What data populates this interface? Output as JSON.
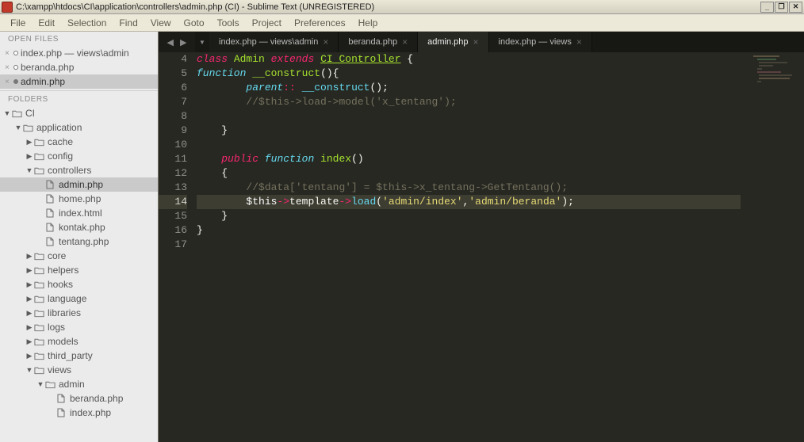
{
  "window": {
    "title": "C:\\xampp\\htdocs\\CI\\application\\controllers\\admin.php (CI) - Sublime Text (UNREGISTERED)"
  },
  "menu": [
    "File",
    "Edit",
    "Selection",
    "Find",
    "View",
    "Goto",
    "Tools",
    "Project",
    "Preferences",
    "Help"
  ],
  "openfiles_head": "OPEN FILES",
  "openfiles": [
    {
      "label": "index.php — views\\admin",
      "active": false
    },
    {
      "label": "beranda.php",
      "active": false
    },
    {
      "label": "admin.php",
      "active": true
    }
  ],
  "folders_head": "FOLDERS",
  "folders": [
    {
      "d": 0,
      "type": "folder",
      "open": true,
      "label": "CI"
    },
    {
      "d": 1,
      "type": "folder",
      "open": true,
      "label": "application"
    },
    {
      "d": 2,
      "type": "folder",
      "open": false,
      "label": "cache"
    },
    {
      "d": 2,
      "type": "folder",
      "open": false,
      "label": "config"
    },
    {
      "d": 2,
      "type": "folder",
      "open": true,
      "label": "controllers"
    },
    {
      "d": 3,
      "type": "file",
      "label": "admin.php",
      "active": true
    },
    {
      "d": 3,
      "type": "file",
      "label": "home.php"
    },
    {
      "d": 3,
      "type": "file",
      "label": "index.html"
    },
    {
      "d": 3,
      "type": "file",
      "label": "kontak.php"
    },
    {
      "d": 3,
      "type": "file",
      "label": "tentang.php"
    },
    {
      "d": 2,
      "type": "folder",
      "open": false,
      "label": "core"
    },
    {
      "d": 2,
      "type": "folder",
      "open": false,
      "label": "helpers"
    },
    {
      "d": 2,
      "type": "folder",
      "open": false,
      "label": "hooks"
    },
    {
      "d": 2,
      "type": "folder",
      "open": false,
      "label": "language"
    },
    {
      "d": 2,
      "type": "folder",
      "open": false,
      "label": "libraries"
    },
    {
      "d": 2,
      "type": "folder",
      "open": false,
      "label": "logs"
    },
    {
      "d": 2,
      "type": "folder",
      "open": false,
      "label": "models"
    },
    {
      "d": 2,
      "type": "folder",
      "open": false,
      "label": "third_party"
    },
    {
      "d": 2,
      "type": "folder",
      "open": true,
      "label": "views"
    },
    {
      "d": 3,
      "type": "folder",
      "open": true,
      "label": "admin"
    },
    {
      "d": 4,
      "type": "file",
      "label": "beranda.php"
    },
    {
      "d": 4,
      "type": "file",
      "label": "index.php"
    }
  ],
  "tabs": [
    {
      "label": "index.php — views\\admin",
      "active": false
    },
    {
      "label": "beranda.php",
      "active": false
    },
    {
      "label": "admin.php",
      "active": true
    },
    {
      "label": "index.php — views",
      "active": false
    }
  ],
  "code": {
    "first_line": 4,
    "active_line": 14,
    "lines": [
      [
        [
          "kw",
          "class"
        ],
        [
          "plain",
          " "
        ],
        [
          "type",
          "Admin"
        ],
        [
          "plain",
          " "
        ],
        [
          "kw",
          "extends"
        ],
        [
          "plain",
          " "
        ],
        [
          "typeu",
          "CI_Controller"
        ],
        [
          "plain",
          " {"
        ]
      ],
      [
        [
          "kwi",
          "function"
        ],
        [
          "plain",
          " "
        ],
        [
          "funcname",
          "__construct"
        ],
        [
          "plain",
          "(){"
        ]
      ],
      [
        [
          "plain",
          "        "
        ],
        [
          "kwi",
          "parent"
        ],
        [
          "op",
          "::"
        ],
        [
          "plain",
          " "
        ],
        [
          "func",
          "__construct"
        ],
        [
          "plain",
          "();"
        ]
      ],
      [
        [
          "plain",
          "        "
        ],
        [
          "com",
          "//$this->load->model('x_tentang');"
        ]
      ],
      [
        [
          "plain",
          ""
        ]
      ],
      [
        [
          "plain",
          "    }"
        ]
      ],
      [
        [
          "plain",
          ""
        ]
      ],
      [
        [
          "plain",
          "    "
        ],
        [
          "kw",
          "public"
        ],
        [
          "plain",
          " "
        ],
        [
          "kwi",
          "function"
        ],
        [
          "plain",
          " "
        ],
        [
          "funcname",
          "index"
        ],
        [
          "plain",
          "()"
        ]
      ],
      [
        [
          "plain",
          "    {"
        ]
      ],
      [
        [
          "plain",
          "        "
        ],
        [
          "com",
          "//$data['tentang'] = $this->x_tentang->GetTentang();"
        ]
      ],
      [
        [
          "plain",
          "        "
        ],
        [
          "var",
          "$this"
        ],
        [
          "op",
          "->"
        ],
        [
          "plain",
          "template"
        ],
        [
          "op",
          "->"
        ],
        [
          "func",
          "load"
        ],
        [
          "plain",
          "("
        ],
        [
          "str",
          "'admin/index'"
        ],
        [
          "plain",
          ","
        ],
        [
          "str",
          "'admin/beranda'"
        ],
        [
          "plain",
          ");"
        ]
      ],
      [
        [
          "plain",
          "    }"
        ]
      ],
      [
        [
          "plain",
          "}"
        ]
      ],
      [
        [
          "plain",
          ""
        ]
      ]
    ]
  }
}
